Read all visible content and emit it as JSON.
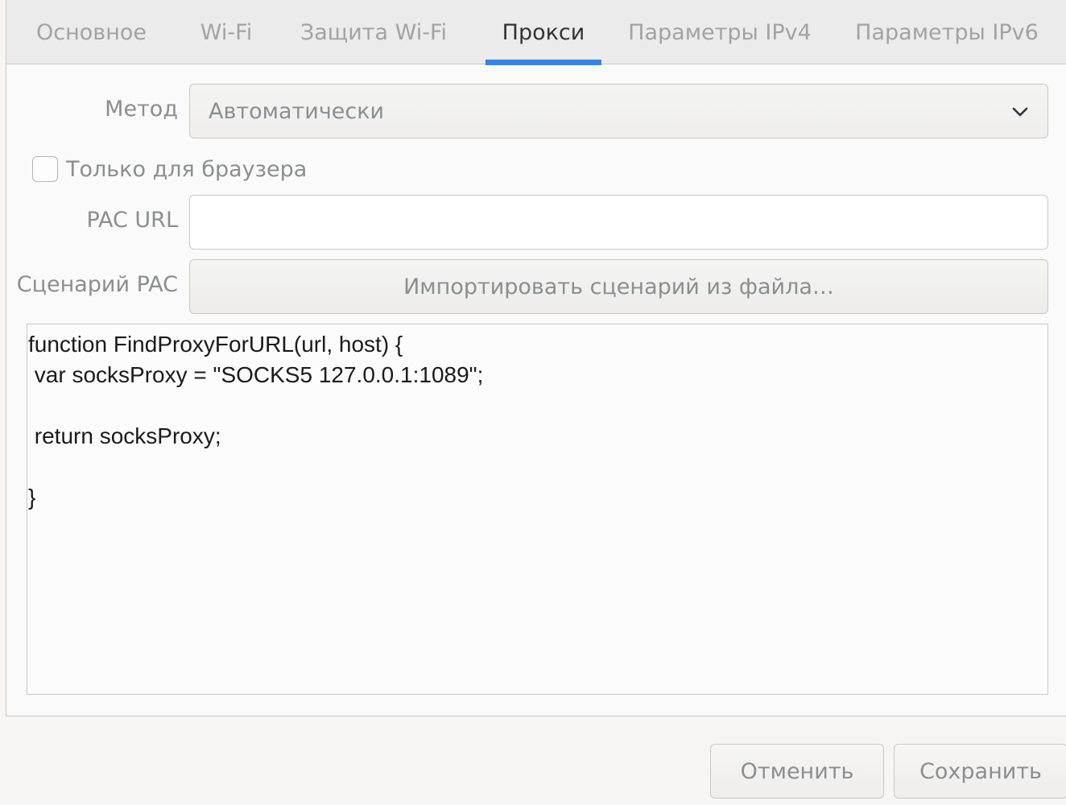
{
  "tabs": [
    {
      "label": "Основное",
      "active": false
    },
    {
      "label": "Wi-Fi",
      "active": false
    },
    {
      "label": "Защита Wi-Fi",
      "active": false
    },
    {
      "label": "Прокси",
      "active": true
    },
    {
      "label": "Параметры IPv4",
      "active": false
    },
    {
      "label": "Параметры IPv6",
      "active": false
    }
  ],
  "method": {
    "label": "Метод",
    "value": "Автоматически",
    "icon": "chevron-down-icon"
  },
  "browser_only": {
    "label": "Только для браузера",
    "checked": false
  },
  "pac_url": {
    "label": "PAC URL",
    "value": "",
    "placeholder": ""
  },
  "pac_script": {
    "label": "Сценарий PAC",
    "import_label": "Импортировать сценарий из файла…",
    "content": "function FindProxyForURL(url, host) {\n var socksProxy = \"SOCKS5 127.0.0.1:1089\";\n\n return socksProxy;\n\n}"
  },
  "actions": {
    "cancel_label": "Отменить",
    "save_label": "Сохранить"
  },
  "colors": {
    "accent": "#3584e4",
    "inactive_text": "#a2a3a1",
    "active_text": "#2e3436"
  }
}
